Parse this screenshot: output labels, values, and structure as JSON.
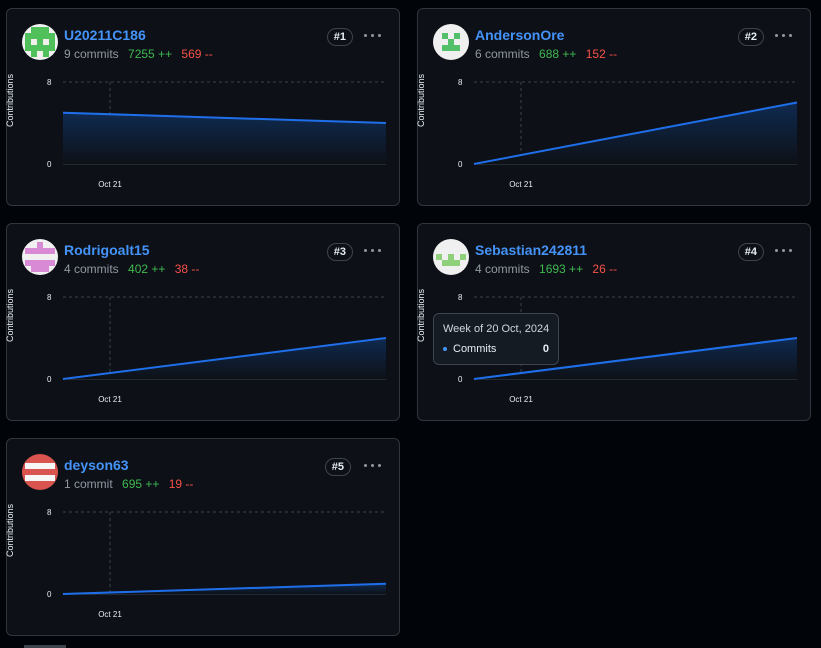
{
  "colors": {
    "link": "#4493f8",
    "additions": "#3fb950",
    "deletions": "#f85149",
    "line": "#1f6feb",
    "area_top": "#0f2a50",
    "area_bottom": "#0d1117"
  },
  "contributors": [
    {
      "username": "U20211C186",
      "commits": "9 commits",
      "additions": "7255 ++",
      "deletions": "569 --",
      "rank": "#1",
      "avatar": {
        "icon": "identicon-green",
        "color": "#4fc05a"
      },
      "chart_data": {
        "type": "area",
        "ylabel": "Contributions",
        "ylim": [
          0,
          8
        ],
        "y_ticks": [
          "8",
          "0"
        ],
        "x_tick_labels": [
          "Oct 21"
        ],
        "values": [
          5,
          4
        ]
      }
    },
    {
      "username": "AndersonOre",
      "commits": "6 commits",
      "additions": "688 ++",
      "deletions": "152 --",
      "rank": "#2",
      "avatar": {
        "icon": "identicon-green-sparse",
        "color": "#55c06a"
      },
      "chart_data": {
        "type": "area",
        "ylabel": "Contributions",
        "ylim": [
          0,
          8
        ],
        "y_ticks": [
          "8",
          "0"
        ],
        "x_tick_labels": [
          "Oct 21"
        ],
        "values": [
          0,
          6
        ]
      }
    },
    {
      "username": "Rodrigoalt15",
      "commits": "4 commits",
      "additions": "402 ++",
      "deletions": "38 --",
      "rank": "#3",
      "avatar": {
        "icon": "identicon-pink",
        "color": "#d98ad4"
      },
      "chart_data": {
        "type": "area",
        "ylabel": "Contributions",
        "ylim": [
          0,
          8
        ],
        "y_ticks": [
          "8",
          "0"
        ],
        "x_tick_labels": [
          "Oct 21"
        ],
        "values": [
          0,
          4
        ]
      }
    },
    {
      "username": "Sebastian242811",
      "commits": "4 commits",
      "additions": "1693 ++",
      "deletions": "26 --",
      "rank": "#4",
      "avatar": {
        "icon": "identicon-lightgreen",
        "color": "#8fd07a"
      },
      "chart_data": {
        "type": "area",
        "ylabel": "Contributions",
        "ylim": [
          0,
          8
        ],
        "y_ticks": [
          "8",
          "0"
        ],
        "x_tick_labels": [
          "Oct 21"
        ],
        "values": [
          0,
          4
        ]
      }
    },
    {
      "username": "deyson63",
      "commits": "1 commit",
      "additions": "695 ++",
      "deletions": "19 --",
      "rank": "#5",
      "avatar": {
        "icon": "identicon-red",
        "color": "#d9534f"
      },
      "chart_data": {
        "type": "area",
        "ylabel": "Contributions",
        "ylim": [
          0,
          8
        ],
        "y_ticks": [
          "8",
          "0"
        ],
        "x_tick_labels": [
          "Oct 21"
        ],
        "values": [
          0,
          1
        ]
      }
    }
  ],
  "tooltip": {
    "title": "Week of 20 Oct, 2024",
    "label": "Commits",
    "value": "0"
  }
}
